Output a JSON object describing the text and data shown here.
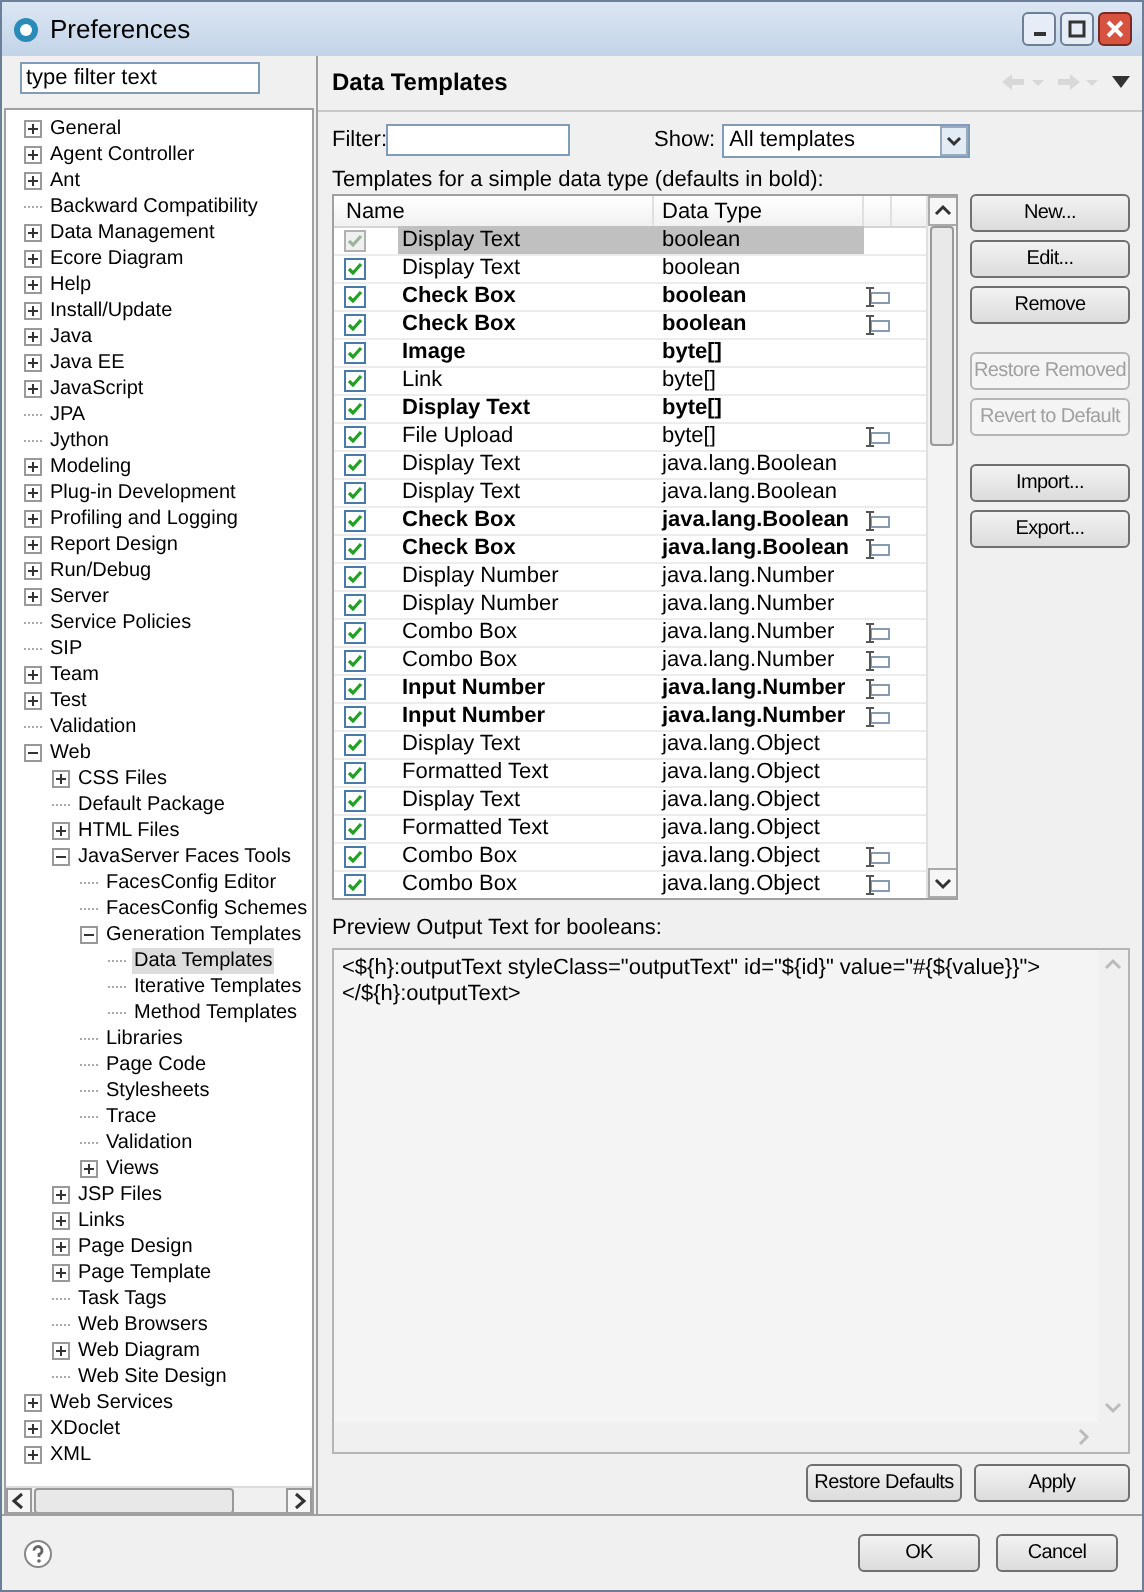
{
  "window": {
    "title": "Preferences"
  },
  "sidebar": {
    "filter": {
      "placeholder": "type filter text"
    },
    "items": [
      {
        "label": "General",
        "kind": "node",
        "expanded": false,
        "selected": false
      },
      {
        "label": "Agent Controller",
        "kind": "node",
        "expanded": false,
        "selected": false
      },
      {
        "label": "Ant",
        "kind": "node",
        "expanded": false,
        "selected": false
      },
      {
        "label": "Backward Compatibility",
        "kind": "leaf",
        "selected": false
      },
      {
        "label": "Data Management",
        "kind": "node",
        "expanded": false,
        "selected": false
      },
      {
        "label": "Ecore Diagram",
        "kind": "node",
        "expanded": false,
        "selected": false
      },
      {
        "label": "Help",
        "kind": "node",
        "expanded": false,
        "selected": false
      },
      {
        "label": "Install/Update",
        "kind": "node",
        "expanded": false,
        "selected": false
      },
      {
        "label": "Java",
        "kind": "node",
        "expanded": false,
        "selected": false
      },
      {
        "label": "Java EE",
        "kind": "node",
        "expanded": false,
        "selected": false
      },
      {
        "label": "JavaScript",
        "kind": "node",
        "expanded": false,
        "selected": false
      },
      {
        "label": "JPA",
        "kind": "leaf",
        "selected": false
      },
      {
        "label": "Jython",
        "kind": "leaf",
        "selected": false
      },
      {
        "label": "Modeling",
        "kind": "node",
        "expanded": false,
        "selected": false
      },
      {
        "label": "Plug-in Development",
        "kind": "node",
        "expanded": false,
        "selected": false
      },
      {
        "label": "Profiling and Logging",
        "kind": "node",
        "expanded": false,
        "selected": false
      },
      {
        "label": "Report Design",
        "kind": "node",
        "expanded": false,
        "selected": false
      },
      {
        "label": "Run/Debug",
        "kind": "node",
        "expanded": false,
        "selected": false
      },
      {
        "label": "Server",
        "kind": "node",
        "expanded": false,
        "selected": false
      },
      {
        "label": "Service Policies",
        "kind": "leaf",
        "selected": false
      },
      {
        "label": "SIP",
        "kind": "leaf",
        "selected": false
      },
      {
        "label": "Team",
        "kind": "node",
        "expanded": false,
        "selected": false
      },
      {
        "label": "Test",
        "kind": "node",
        "expanded": false,
        "selected": false
      },
      {
        "label": "Validation",
        "kind": "leaf",
        "selected": false
      },
      {
        "label": "Web",
        "kind": "node",
        "expanded": true,
        "selected": false,
        "children": [
          {
            "label": "CSS Files",
            "kind": "node",
            "expanded": false,
            "selected": false
          },
          {
            "label": "Default Package",
            "kind": "leaf",
            "selected": false
          },
          {
            "label": "HTML Files",
            "kind": "node",
            "expanded": false,
            "selected": false
          },
          {
            "label": "JavaServer Faces Tools",
            "kind": "node",
            "expanded": true,
            "selected": false,
            "children": [
              {
                "label": "FacesConfig Editor",
                "kind": "leaf",
                "selected": false
              },
              {
                "label": "FacesConfig Schemes",
                "kind": "leaf",
                "selected": false
              },
              {
                "label": "Generation Templates",
                "kind": "node",
                "expanded": true,
                "selected": false,
                "children": [
                  {
                    "label": "Data Templates",
                    "kind": "leaf",
                    "selected": true
                  },
                  {
                    "label": "Iterative Templates",
                    "kind": "leaf",
                    "selected": false
                  },
                  {
                    "label": "Method Templates",
                    "kind": "leaf",
                    "selected": false
                  }
                ]
              },
              {
                "label": "Libraries",
                "kind": "leaf",
                "selected": false
              },
              {
                "label": "Page Code",
                "kind": "leaf",
                "selected": false
              },
              {
                "label": "Stylesheets",
                "kind": "leaf",
                "selected": false
              },
              {
                "label": "Trace",
                "kind": "leaf",
                "selected": false
              },
              {
                "label": "Validation",
                "kind": "leaf",
                "selected": false
              },
              {
                "label": "Views",
                "kind": "node",
                "expanded": false,
                "selected": false
              }
            ]
          },
          {
            "label": "JSP Files",
            "kind": "node",
            "expanded": false,
            "selected": false
          },
          {
            "label": "Links",
            "kind": "node",
            "expanded": false,
            "selected": false
          },
          {
            "label": "Page Design",
            "kind": "node",
            "expanded": false,
            "selected": false
          },
          {
            "label": "Page Template",
            "kind": "node",
            "expanded": false,
            "selected": false
          },
          {
            "label": "Task Tags",
            "kind": "leaf",
            "selected": false
          },
          {
            "label": "Web Browsers",
            "kind": "leaf",
            "selected": false
          },
          {
            "label": "Web Diagram",
            "kind": "node",
            "expanded": false,
            "selected": false
          },
          {
            "label": "Web Site Design",
            "kind": "leaf",
            "selected": false
          }
        ]
      },
      {
        "label": "Web Services",
        "kind": "node",
        "expanded": false,
        "selected": false
      },
      {
        "label": "XDoclet",
        "kind": "node",
        "expanded": false,
        "selected": false
      },
      {
        "label": "XML",
        "kind": "node",
        "expanded": false,
        "selected": false
      }
    ]
  },
  "page": {
    "title": "Data Templates",
    "filter": {
      "label": "Filter:"
    },
    "show": {
      "label": "Show:",
      "value": "All templates"
    },
    "table_caption": "Templates for a simple data type (defaults in bold):",
    "table": {
      "columns": [
        "Name",
        "Data Type"
      ],
      "rows": [
        {
          "name": "Display Text",
          "type": "boolean",
          "default": false,
          "checked": true,
          "disabled": true,
          "selected": true,
          "editor": false
        },
        {
          "name": "Display Text",
          "type": "boolean",
          "default": false,
          "checked": true,
          "disabled": false,
          "selected": false,
          "editor": false
        },
        {
          "name": "Check Box",
          "type": "boolean",
          "default": true,
          "checked": true,
          "disabled": false,
          "selected": false,
          "editor": true
        },
        {
          "name": "Check Box",
          "type": "boolean",
          "default": true,
          "checked": true,
          "disabled": false,
          "selected": false,
          "editor": true
        },
        {
          "name": "Image",
          "type": "byte[]",
          "default": true,
          "checked": true,
          "disabled": false,
          "selected": false,
          "editor": false
        },
        {
          "name": "Link",
          "type": "byte[]",
          "default": false,
          "checked": true,
          "disabled": false,
          "selected": false,
          "editor": false
        },
        {
          "name": "Display Text",
          "type": "byte[]",
          "default": true,
          "checked": true,
          "disabled": false,
          "selected": false,
          "editor": false
        },
        {
          "name": "File Upload",
          "type": "byte[]",
          "default": false,
          "checked": true,
          "disabled": false,
          "selected": false,
          "editor": true
        },
        {
          "name": "Display Text",
          "type": "java.lang.Boolean",
          "default": false,
          "checked": true,
          "disabled": false,
          "selected": false,
          "editor": false
        },
        {
          "name": "Display Text",
          "type": "java.lang.Boolean",
          "default": false,
          "checked": true,
          "disabled": false,
          "selected": false,
          "editor": false
        },
        {
          "name": "Check Box",
          "type": "java.lang.Boolean",
          "default": true,
          "checked": true,
          "disabled": false,
          "selected": false,
          "editor": true
        },
        {
          "name": "Check Box",
          "type": "java.lang.Boolean",
          "default": true,
          "checked": true,
          "disabled": false,
          "selected": false,
          "editor": true
        },
        {
          "name": "Display Number",
          "type": "java.lang.Number",
          "default": false,
          "checked": true,
          "disabled": false,
          "selected": false,
          "editor": false
        },
        {
          "name": "Display Number",
          "type": "java.lang.Number",
          "default": false,
          "checked": true,
          "disabled": false,
          "selected": false,
          "editor": false
        },
        {
          "name": "Combo Box",
          "type": "java.lang.Number",
          "default": false,
          "checked": true,
          "disabled": false,
          "selected": false,
          "editor": true
        },
        {
          "name": "Combo Box",
          "type": "java.lang.Number",
          "default": false,
          "checked": true,
          "disabled": false,
          "selected": false,
          "editor": true
        },
        {
          "name": "Input Number",
          "type": "java.lang.Number",
          "default": true,
          "checked": true,
          "disabled": false,
          "selected": false,
          "editor": true
        },
        {
          "name": "Input Number",
          "type": "java.lang.Number",
          "default": true,
          "checked": true,
          "disabled": false,
          "selected": false,
          "editor": true
        },
        {
          "name": "Display Text",
          "type": "java.lang.Object",
          "default": false,
          "checked": true,
          "disabled": false,
          "selected": false,
          "editor": false
        },
        {
          "name": "Formatted Text",
          "type": "java.lang.Object",
          "default": false,
          "checked": true,
          "disabled": false,
          "selected": false,
          "editor": false
        },
        {
          "name": "Display Text",
          "type": "java.lang.Object",
          "default": false,
          "checked": true,
          "disabled": false,
          "selected": false,
          "editor": false
        },
        {
          "name": "Formatted Text",
          "type": "java.lang.Object",
          "default": false,
          "checked": true,
          "disabled": false,
          "selected": false,
          "editor": false
        },
        {
          "name": "Combo Box",
          "type": "java.lang.Object",
          "default": false,
          "checked": true,
          "disabled": false,
          "selected": false,
          "editor": true
        },
        {
          "name": "Combo Box",
          "type": "java.lang.Object",
          "default": false,
          "checked": true,
          "disabled": false,
          "selected": false,
          "editor": true
        }
      ]
    },
    "button_groups": [
      [
        {
          "label": "New...",
          "disabled": false
        },
        {
          "label": "Edit...",
          "disabled": false
        },
        {
          "label": "Remove",
          "disabled": false
        }
      ],
      [
        {
          "label": "Restore Removed",
          "disabled": true
        },
        {
          "label": "Revert to Default",
          "disabled": true
        }
      ],
      [
        {
          "label": "Import...",
          "disabled": false
        },
        {
          "label": "Export...",
          "disabled": false
        }
      ]
    ],
    "preview": {
      "label": "Preview Output Text for booleans:",
      "lines": [
        "<${h}:outputText styleClass=\"outputText\" id=\"${id}\" value=\"#{${value}}\">",
        "</${h}:outputText>"
      ]
    },
    "buttons": [
      "Restore Defaults",
      "Apply"
    ]
  },
  "dialog_buttons": [
    "OK",
    "Cancel"
  ]
}
